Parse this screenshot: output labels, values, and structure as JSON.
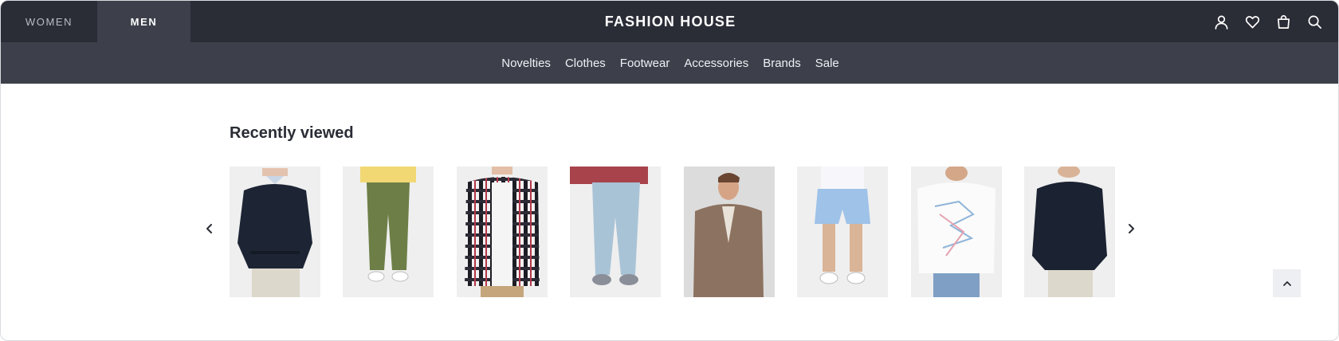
{
  "header": {
    "gender_tabs": [
      {
        "label": "WOMEN",
        "active": false
      },
      {
        "label": "MEN",
        "active": true
      }
    ],
    "brand": "FASHION HOUSE",
    "actions": [
      "user-icon",
      "heart-icon",
      "bag-icon",
      "search-icon"
    ]
  },
  "nav": {
    "categories": [
      "Novelties",
      "Clothes",
      "Footwear",
      "Accessories",
      "Brands",
      "Sale"
    ]
  },
  "recently_viewed": {
    "title": "Recently viewed",
    "products": [
      {
        "name": "navy sweater"
      },
      {
        "name": "olive chinos"
      },
      {
        "name": "plaid shirt"
      },
      {
        "name": "light blue jeans"
      },
      {
        "name": "brown blazer"
      },
      {
        "name": "blue shorts"
      },
      {
        "name": "printed white t-shirt"
      },
      {
        "name": "navy sweater back"
      }
    ]
  },
  "colors": {
    "header_bg": "#2a2c36",
    "nav_bg": "#3d404b",
    "card_bg": "#eeeeee"
  }
}
